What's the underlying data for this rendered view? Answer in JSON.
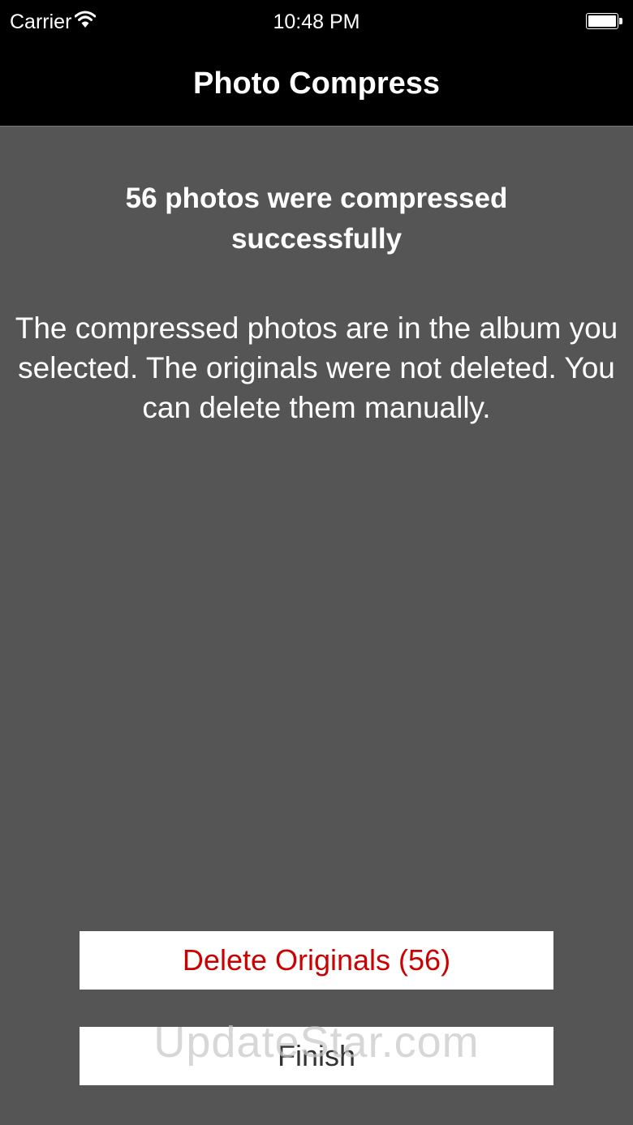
{
  "status_bar": {
    "carrier": "Carrier",
    "time": "10:48 PM"
  },
  "nav": {
    "title": "Photo Compress"
  },
  "content": {
    "headline": "56 photos were compressed successfully",
    "message": "The compressed photos are in the album you selected. The originals were not deleted. You can delete them manually."
  },
  "buttons": {
    "delete_label": "Delete Originals (56)",
    "finish_label": "Finish"
  },
  "watermark": "UpdateStar.com",
  "colors": {
    "background": "#555555",
    "bar": "#000000",
    "destructive": "#cc0000"
  }
}
